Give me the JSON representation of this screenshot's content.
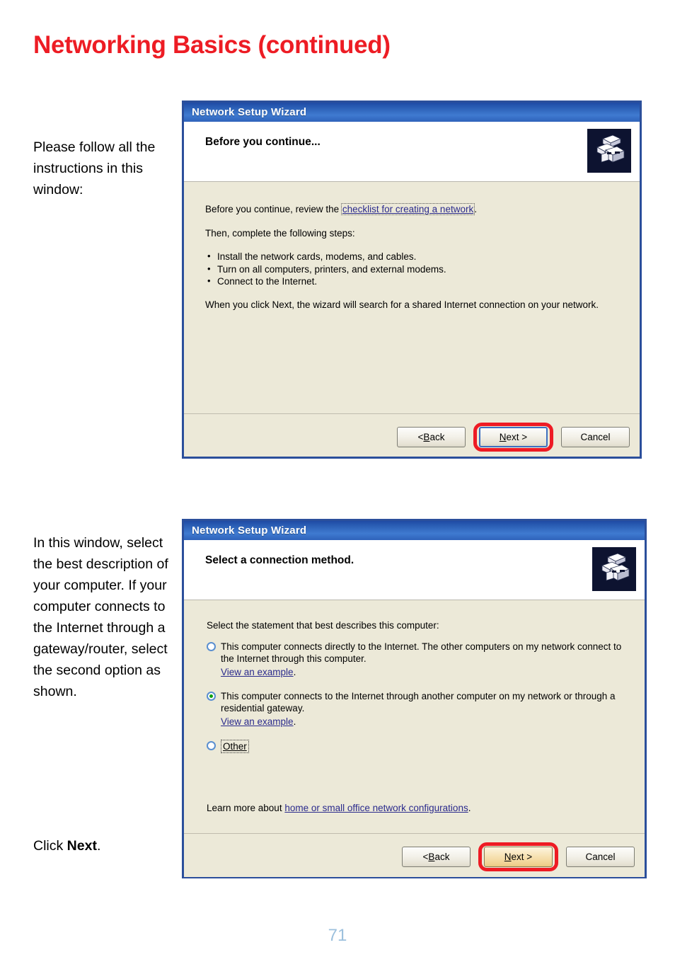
{
  "page": {
    "title": "Networking Basics (continued)",
    "number": "71",
    "title_color": "#ed1c24",
    "page_number_color": "#9cc0dd"
  },
  "notes": {
    "note_1": "Please follow all the instructions in this window:",
    "note_2": "In this window, select the best description of your computer. If your computer connects to the Internet through a gateway/router, select the second option as shown.",
    "note_3_prefix": "Click ",
    "note_3_bold": "Next",
    "note_3_suffix": "."
  },
  "wizard_1": {
    "window_title": "Network Setup Wizard",
    "header_title": "Before you continue...",
    "icon": "network-computers-icon",
    "paragraph_1_prefix": "Before you continue, review the ",
    "paragraph_1_link": "checklist for creating a network",
    "paragraph_1_suffix": ".",
    "paragraph_2": "Then, complete the following steps:",
    "bullets": [
      "Install the network cards, modems, and cables.",
      "Turn on all computers, printers, and external modems.",
      "Connect to the Internet."
    ],
    "paragraph_3": "When you click Next, the wizard will search for a shared Internet connection on your network.",
    "buttons": {
      "back": "< Back",
      "back_mnemonic": "B",
      "next": "Next >",
      "next_mnemonic": "N",
      "cancel": "Cancel"
    },
    "highlighted_button": "next",
    "highlight_color": "#ee1b24"
  },
  "wizard_2": {
    "window_title": "Network Setup Wizard",
    "header_title": "Select a connection method.",
    "icon": "network-computers-icon",
    "intro": "Select the statement that best describes this computer:",
    "options": [
      {
        "label": "This computer connects directly to the Internet. The other computers on my network connect to the Internet through this computer.",
        "link": "View an example",
        "link_suffix": ".",
        "selected": false,
        "focused": false
      },
      {
        "label": "This computer connects to the Internet through another computer on my network or through a residential gateway.",
        "link": "View an example",
        "link_suffix": ".",
        "selected": true,
        "focused": false
      },
      {
        "label": "Other",
        "link": "",
        "link_suffix": "",
        "selected": false,
        "focused": true
      }
    ],
    "learn_more_prefix": "Learn more about ",
    "learn_more_link": "home or small office network configurations",
    "learn_more_suffix": ".",
    "buttons": {
      "back": "< Back",
      "back_mnemonic": "B",
      "next": "Next >",
      "next_mnemonic": "N",
      "cancel": "Cancel"
    },
    "highlighted_button": "next",
    "highlight_color": "#ee1b24"
  }
}
